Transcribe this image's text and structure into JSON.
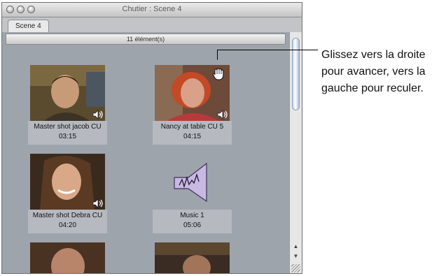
{
  "window": {
    "title": "Chutier : Scene 4",
    "tab_label": "Scene 4",
    "item_count": "11 élément(s)"
  },
  "clips": [
    {
      "name": "Master shot jacob CU",
      "duration": "03:15",
      "has_audio": true
    },
    {
      "name": "Nancy at table CU 5",
      "duration": "04:15",
      "has_audio": true
    },
    {
      "name": "Master shot Debra CU",
      "duration": "04:20",
      "has_audio": true
    },
    {
      "name": "Music 1",
      "duration": "05:06",
      "type": "audio"
    }
  ],
  "callout": {
    "text": "Glissez vers la droite pour avancer, vers la gauche pour reculer."
  },
  "icons": [
    "speaker-icon",
    "hand-cursor-icon",
    "music-clip-icon",
    "scroll-up-arrow",
    "scroll-down-arrow",
    "resize-grip"
  ]
}
